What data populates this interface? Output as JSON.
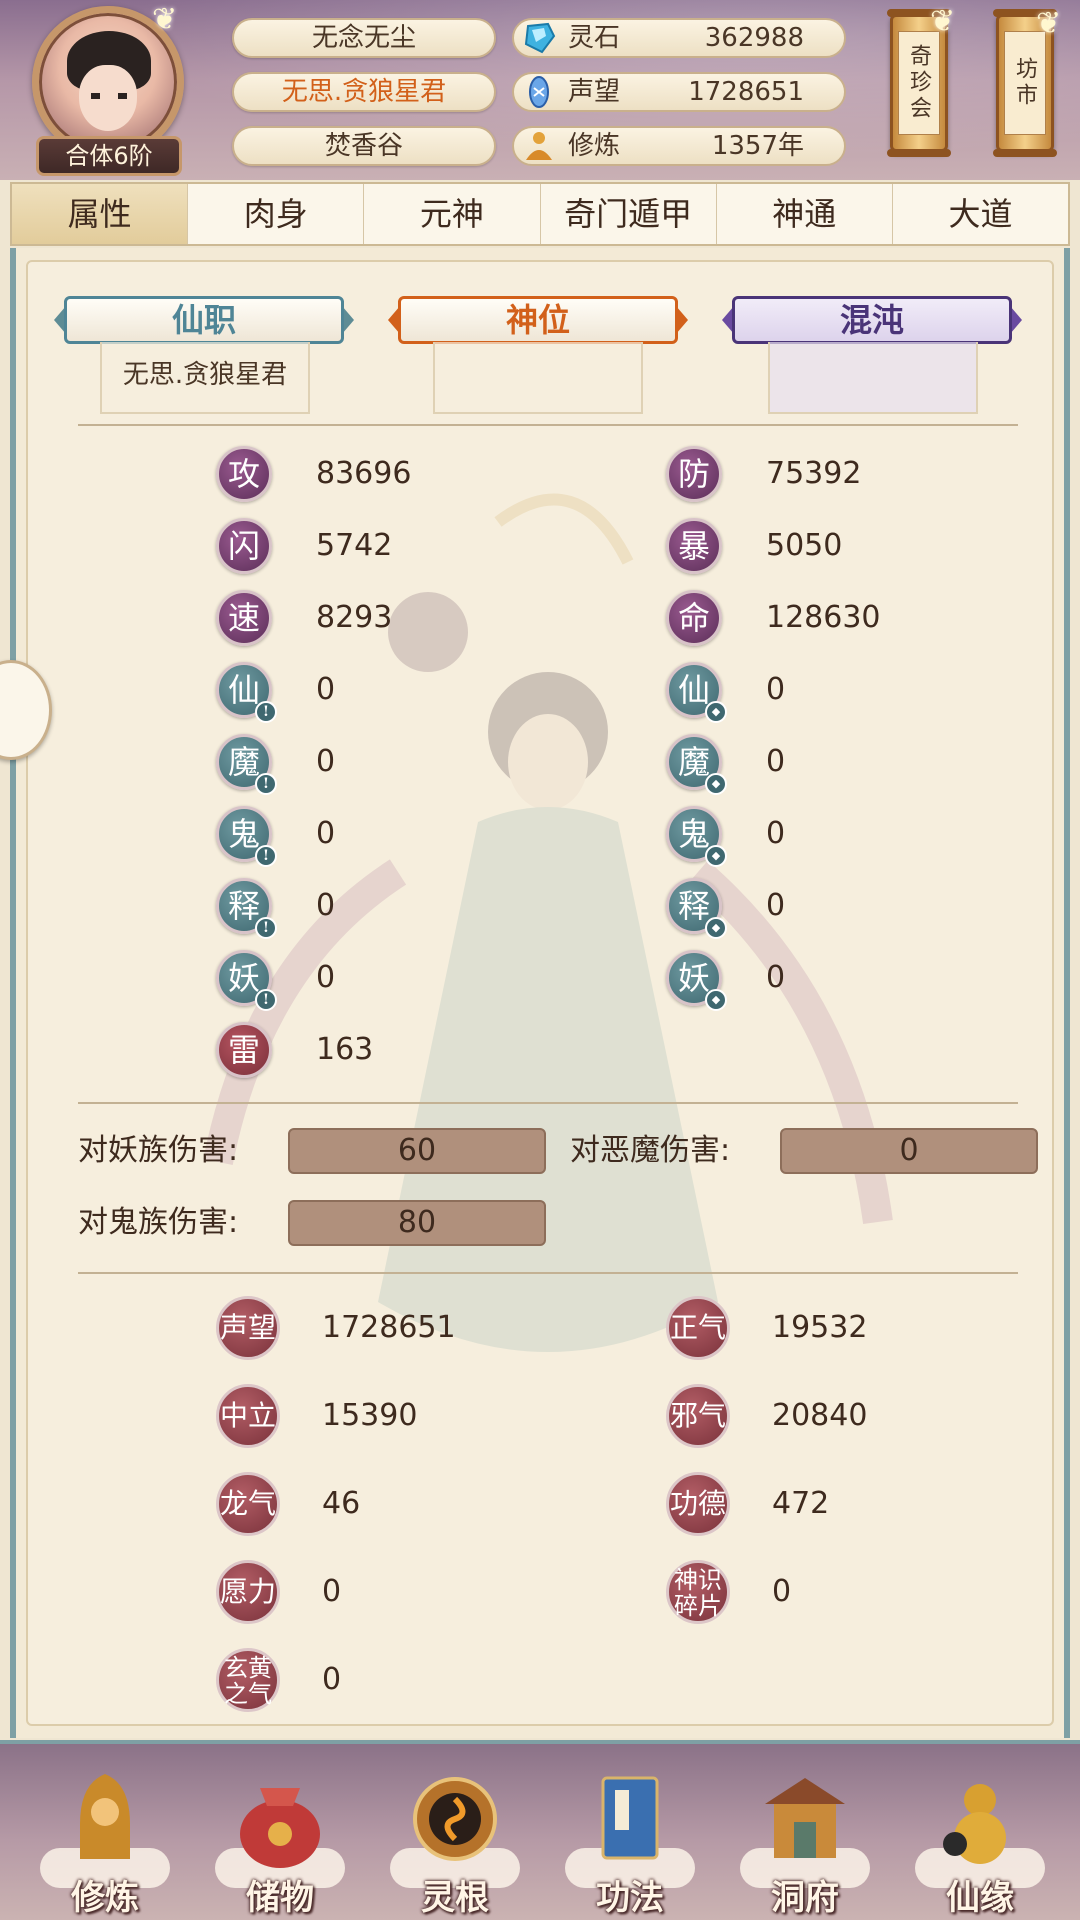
{
  "header": {
    "rank_badge": "合体6阶",
    "name": "无念无尘",
    "title": "无思.贪狼星君",
    "sect": "焚香谷",
    "resources": [
      {
        "label": "灵石",
        "value": "362988",
        "icon": "spirit-stone-icon"
      },
      {
        "label": "声望",
        "value": "1728651",
        "icon": "reputation-icon"
      },
      {
        "label": "修炼",
        "value": "1357年",
        "icon": "meditation-icon"
      }
    ],
    "scroll_buttons": [
      {
        "label": "奇珍会"
      },
      {
        "label": "坊市"
      }
    ]
  },
  "tabs": [
    "属性",
    "肉身",
    "元神",
    "奇门遁甲",
    "神通",
    "大道"
  ],
  "active_tab": "属性",
  "positions": [
    {
      "label": "仙职",
      "value": "无思.贪狼星君",
      "color": "#5e8c95"
    },
    {
      "label": "神位",
      "value": "",
      "color": "#d2601a"
    },
    {
      "label": "混沌",
      "value": "",
      "color": "#6a4aa0"
    }
  ],
  "stats_left": [
    {
      "char": "攻",
      "value": "83696",
      "style": "purple"
    },
    {
      "char": "闪",
      "value": "5742",
      "style": "purple"
    },
    {
      "char": "速",
      "value": "8293",
      "style": "purple"
    },
    {
      "char": "仙",
      "value": "0",
      "style": "teal",
      "mark": "!"
    },
    {
      "char": "魔",
      "value": "0",
      "style": "teal",
      "mark": "!"
    },
    {
      "char": "鬼",
      "value": "0",
      "style": "teal",
      "mark": "!"
    },
    {
      "char": "释",
      "value": "0",
      "style": "teal",
      "mark": "!"
    },
    {
      "char": "妖",
      "value": "0",
      "style": "teal",
      "mark": "!"
    },
    {
      "char": "雷",
      "value": "163",
      "style": "red"
    }
  ],
  "stats_right": [
    {
      "char": "防",
      "value": "75392",
      "style": "purple"
    },
    {
      "char": "暴",
      "value": "5050",
      "style": "purple"
    },
    {
      "char": "命",
      "value": "128630",
      "style": "purple"
    },
    {
      "char": "仙",
      "value": "0",
      "style": "teal",
      "mark": "◆"
    },
    {
      "char": "魔",
      "value": "0",
      "style": "teal",
      "mark": "◆"
    },
    {
      "char": "鬼",
      "value": "0",
      "style": "teal",
      "mark": "◆"
    },
    {
      "char": "释",
      "value": "0",
      "style": "teal",
      "mark": "◆"
    },
    {
      "char": "妖",
      "value": "0",
      "style": "teal",
      "mark": "◆"
    }
  ],
  "damage": [
    {
      "label": "对妖族伤害:",
      "value": "60"
    },
    {
      "label": "对恶魔伤害:",
      "value": "0"
    },
    {
      "label": "对鬼族伤害:",
      "value": "80"
    }
  ],
  "reputation_left": [
    {
      "char": "声望",
      "value": "1728651"
    },
    {
      "char": "中立",
      "value": "15390"
    },
    {
      "char": "龙气",
      "value": "46"
    },
    {
      "char": "愿力",
      "value": "0"
    },
    {
      "char": "玄黄之气",
      "value": "0"
    }
  ],
  "reputation_right": [
    {
      "char": "正气",
      "value": "19532"
    },
    {
      "char": "邪气",
      "value": "20840"
    },
    {
      "char": "功德",
      "value": "472"
    },
    {
      "char": "神识碎片",
      "value": "0"
    }
  ],
  "bottom_nav": [
    {
      "label": "修炼",
      "icon": "meditation-figure-icon"
    },
    {
      "label": "储物",
      "icon": "storage-bag-icon"
    },
    {
      "label": "灵根",
      "icon": "spirit-root-icon"
    },
    {
      "label": "功法",
      "icon": "technique-book-icon"
    },
    {
      "label": "洞府",
      "icon": "cave-mansion-icon"
    },
    {
      "label": "仙缘",
      "icon": "immortal-gourd-icon"
    }
  ]
}
